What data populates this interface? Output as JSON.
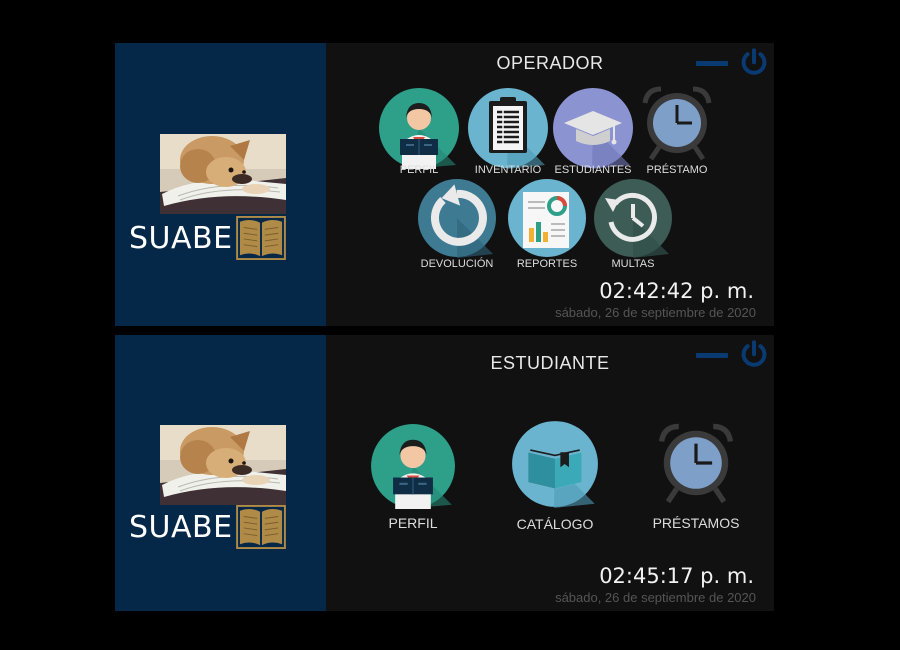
{
  "operator_window": {
    "brand": "SUABE",
    "title": "OPERADOR",
    "tiles": [
      {
        "label": "PERFIL",
        "icon": "reader-profile-icon"
      },
      {
        "label": "INVENTARIO",
        "icon": "clipboard-icon"
      },
      {
        "label": "ESTUDIANTES",
        "icon": "graduation-cap-icon"
      },
      {
        "label": "PRÉSTAMO",
        "icon": "alarm-clock-icon"
      },
      {
        "label": "DEVOLUCIÓN",
        "icon": "return-arrow-icon"
      },
      {
        "label": "REPORTES",
        "icon": "reports-icon"
      },
      {
        "label": "MULTAS",
        "icon": "history-clock-icon"
      }
    ],
    "clock": "02:42:42 p. m.",
    "date": "sábado, 26 de septiembre de 2020"
  },
  "student_window": {
    "brand": "SUABE",
    "title": "ESTUDIANTE",
    "tiles": [
      {
        "label": "PERFIL",
        "icon": "reader-profile-icon"
      },
      {
        "label": "CATÁLOGO",
        "icon": "book-icon"
      },
      {
        "label": "PRÉSTAMOS",
        "icon": "alarm-clock-icon"
      }
    ],
    "clock": "02:45:17 p. m.",
    "date": "sábado, 26 de septiembre de 2020"
  },
  "colors": {
    "sidebar": "#052849",
    "panel": "#111111",
    "accent_blue": "#0a3a72",
    "teal": "#2ea089",
    "light_blue": "#6ab4cf",
    "book_gold": "#b08a47"
  }
}
